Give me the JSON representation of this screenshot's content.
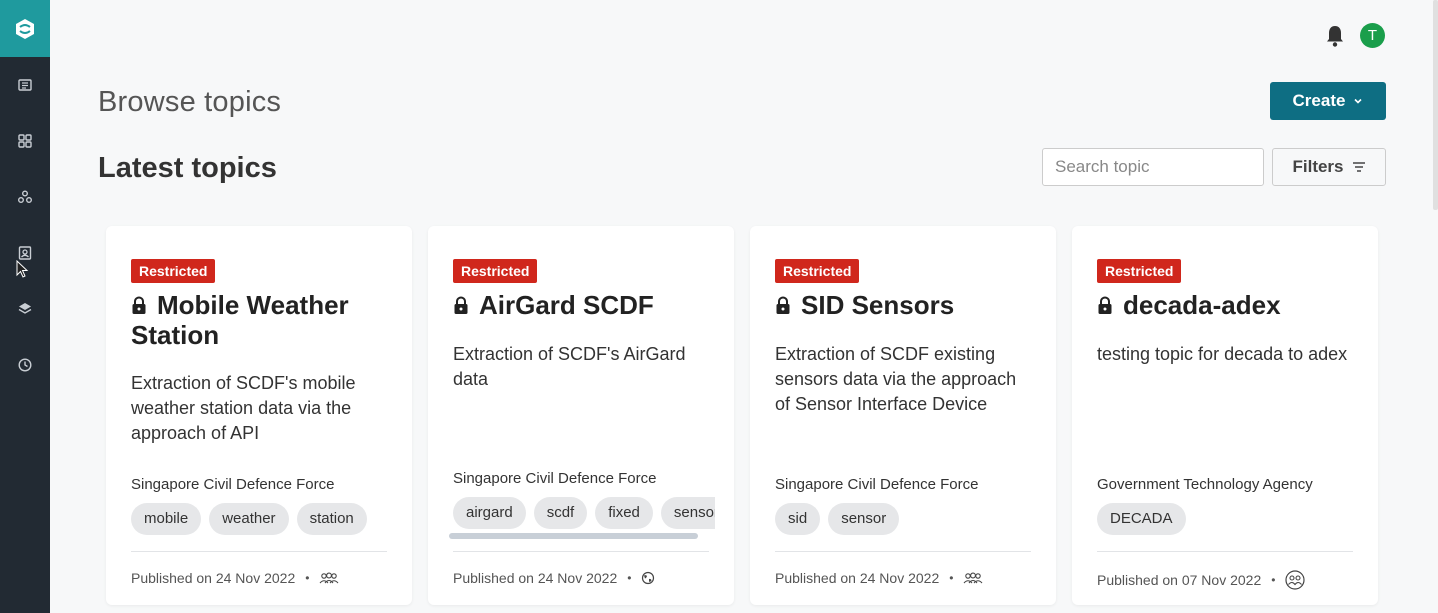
{
  "sidebar": {
    "logo": "app-logo",
    "items": [
      {
        "icon": "news-icon"
      },
      {
        "icon": "grid-icon"
      },
      {
        "icon": "network-icon"
      },
      {
        "icon": "contacts-icon"
      },
      {
        "icon": "layers-icon"
      },
      {
        "icon": "clock-icon"
      }
    ]
  },
  "header": {
    "notification_icon": "bell-icon",
    "avatar_initial": "T",
    "avatar_color": "#1a9e4b"
  },
  "page": {
    "title": "Browse topics",
    "create_label": "Create",
    "section_title": "Latest topics",
    "search_placeholder": "Search topic",
    "filters_label": "Filters"
  },
  "colors": {
    "sidebar_bg": "#222a33",
    "logo_bg": "#1f9a9e",
    "primary_button": "#0e6e83",
    "restricted_badge": "#d0271c"
  },
  "cards": [
    {
      "badge": "Restricted",
      "title": "Mobile Weather Station",
      "description": "Extraction of SCDF's mobile weather station data via the approach of API",
      "organisation": "Singapore Civil Defence Force",
      "tags": [
        "mobile",
        "weather",
        "station"
      ],
      "published": "Published on 24 Nov 2022",
      "visibility_icon": "group-icon"
    },
    {
      "badge": "Restricted",
      "title": "AirGard SCDF",
      "description": "Extraction of SCDF's AirGard data",
      "organisation": "Singapore Civil Defence Force",
      "tags": [
        "airgard",
        "scdf",
        "fixed",
        "sensor"
      ],
      "published": "Published on 24 Nov 2022",
      "visibility_icon": "globe-icon"
    },
    {
      "badge": "Restricted",
      "title": "SID Sensors",
      "description": "Extraction of SCDF existing sensors data via the approach of Sensor Interface Device",
      "organisation": "Singapore Civil Defence Force",
      "tags": [
        "sid",
        "sensor"
      ],
      "published": "Published on 24 Nov 2022",
      "visibility_icon": "group-icon"
    },
    {
      "badge": "Restricted",
      "title": "decada-adex",
      "description": "testing topic for decada to adex",
      "organisation": "Government Technology Agency",
      "tags": [
        "DECADA"
      ],
      "published": "Published on 07 Nov 2022",
      "visibility_icon": "circle-group-icon"
    }
  ]
}
